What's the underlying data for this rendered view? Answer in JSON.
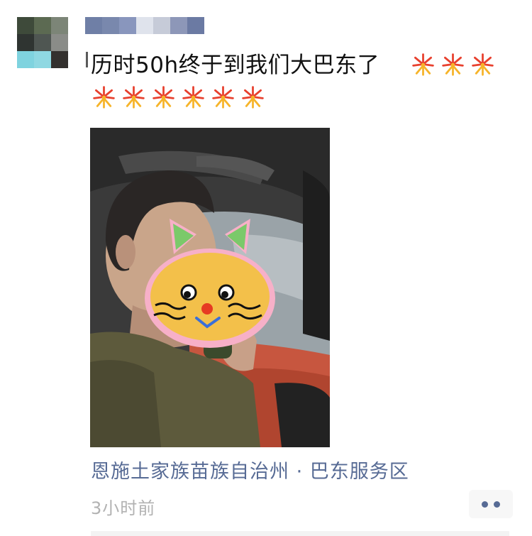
{
  "post": {
    "text": "历时50h终于到我们大巴东了",
    "emoji_name": "fireworks-emoji",
    "location": "恩施土家族苗族自治州 · 巴东服务区",
    "time": "3小时前"
  },
  "colors": {
    "link": "#576b95",
    "time": "#b2b2b2",
    "text": "#111111",
    "action_bg": "#f7f7f7"
  },
  "icons": {
    "more": "more-dots-icon"
  }
}
